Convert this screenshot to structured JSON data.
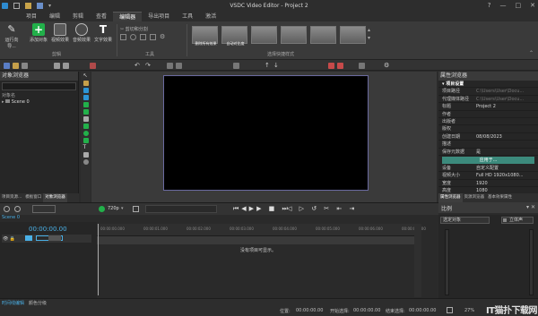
{
  "window": {
    "title": "VSDC Video Editor - Project 2"
  },
  "menu": {
    "tabs": [
      "项目",
      "编辑",
      "剪辑",
      "查看",
      "编辑器",
      "导出项目",
      "工具",
      "激活"
    ],
    "active_index": 4
  },
  "ribbon": {
    "buttons": [
      {
        "label": "运行向导...",
        "icon": "wand-icon"
      },
      {
        "label": "添加对象",
        "icon": "add-object-icon"
      },
      {
        "label": "视频效果",
        "icon": "video-effects-icon"
      },
      {
        "label": "音频效果",
        "icon": "audio-effects-icon"
      },
      {
        "label": "文字效果",
        "icon": "text-effects-icon"
      }
    ],
    "group_labels": {
      "edit": "剪辑",
      "tools": "工具",
      "quick_styles": "选择快捷样式"
    },
    "tool_items": [
      "剪切和分割",
      "",
      ""
    ],
    "style_thumbs": [
      "删除所有效果",
      "自动对比度",
      "",
      "",
      "",
      ""
    ]
  },
  "object_explorer": {
    "title": "对象浏览器",
    "header": "对象名",
    "items": [
      "Scene 0"
    ],
    "tabs": [
      "项目资源...",
      "模板窗口",
      "对象浏览器"
    ]
  },
  "properties": {
    "title": "属性浏览器",
    "section": "项目设置",
    "rows": [
      {
        "k": "项目路径",
        "v": "C:\\Users\\User\\Docu...",
        "dim": true
      },
      {
        "k": "代理媒体路径",
        "v": "C:\\Users\\User\\Docu...",
        "dim": true
      },
      {
        "k": "标题",
        "v": "Project 2"
      },
      {
        "k": "作者",
        "v": ""
      },
      {
        "k": "出版者",
        "v": ""
      },
      {
        "k": "版权",
        "v": ""
      },
      {
        "k": "创建日期",
        "v": "08/08/2023"
      },
      {
        "k": "描述",
        "v": ""
      },
      {
        "k": "保存元数据",
        "v": "是"
      }
    ],
    "apply_label": "应用于...",
    "rows2": [
      {
        "k": "设备",
        "v": "自定义配置"
      },
      {
        "k": "视频大小",
        "v": "Full HD 1920x1080..."
      },
      {
        "k": "宽度",
        "v": "1920"
      },
      {
        "k": "高度",
        "v": "1080"
      }
    ],
    "tabs": [
      "属性浏览器",
      "资源浏览器",
      "基本效果属性"
    ]
  },
  "playback": {
    "quality": "720p",
    "zoom_label": "比例",
    "zoom_percent": "27%"
  },
  "timeline": {
    "scene_tab": "Scene 0",
    "time": "00:00:00.00",
    "empty_message": "没有项目可显示。",
    "ruler_ticks": [
      "00:00:00.000",
      "00:00:01.000",
      "00:00:02.000",
      "00:00:03.000",
      "00:00:04.000",
      "00:00:05.000",
      "00:00:06.000",
      "00:00:07.000"
    ],
    "bottom_tabs": [
      "时间线编辑",
      "颜色分级"
    ]
  },
  "meter": {
    "title": "比例",
    "object_label": "选定对象",
    "mode_label": "立体声"
  },
  "statusbar": {
    "position_label": "位置:",
    "position": "00:00:00.00",
    "start_label": "开始选择:",
    "start": "00:00:00.00",
    "end_label": "结束选择:",
    "end": "00:00:00.00",
    "zoom": "27%",
    "watermark": "IT猫扑下载网"
  },
  "colors": {
    "accent": "#3c8a7c",
    "add_green": "#22b04a",
    "canvas": "#000000"
  }
}
